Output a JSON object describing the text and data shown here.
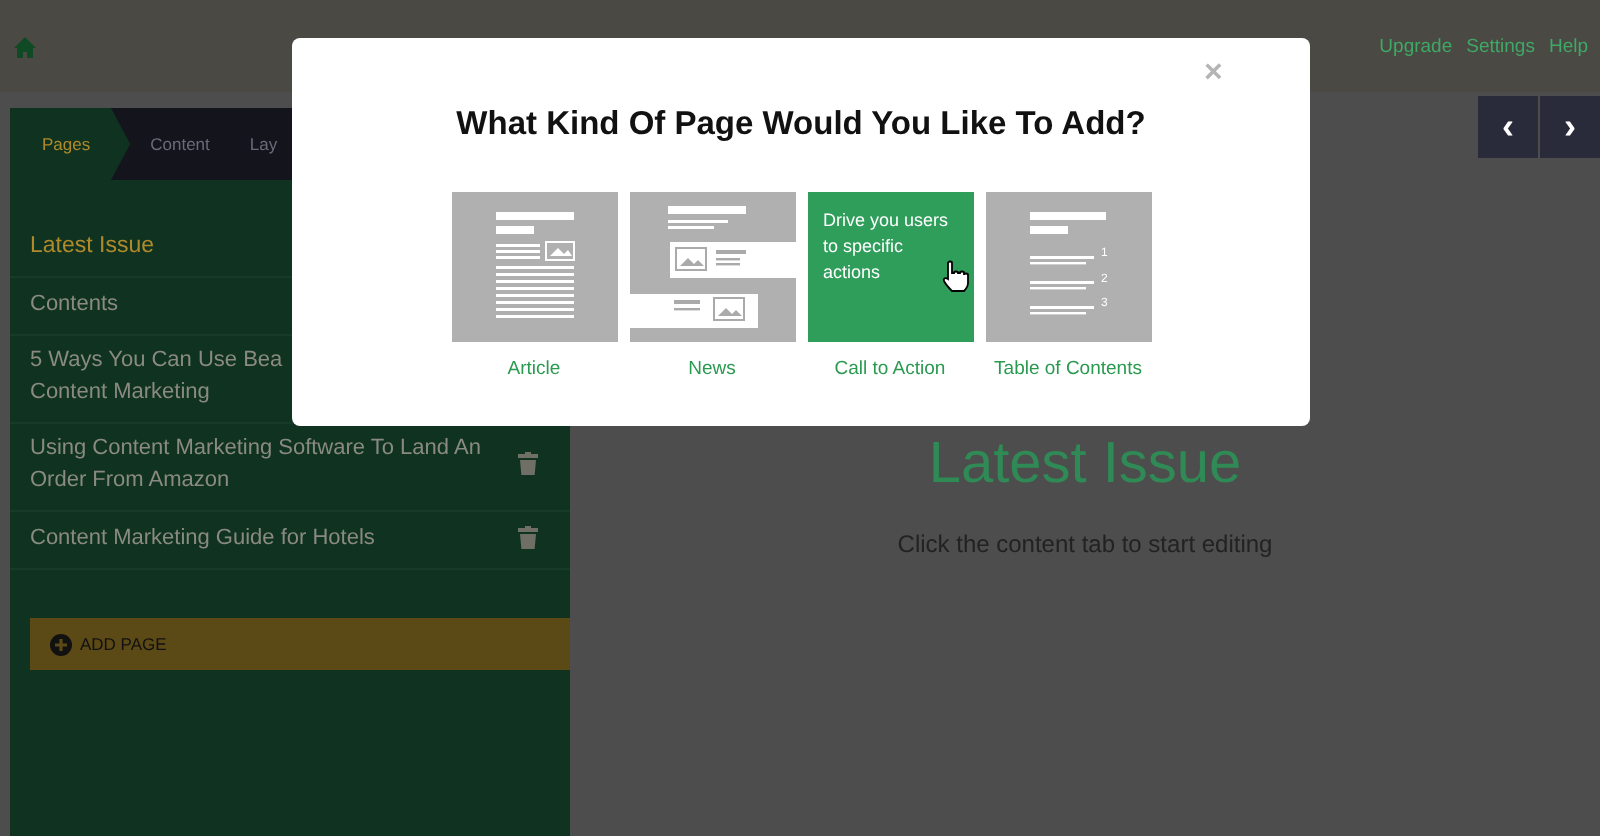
{
  "top_links": [
    "Upgrade",
    "Settings",
    "Help"
  ],
  "sidebar": {
    "tabs": [
      {
        "label": "Pages",
        "selected": true
      },
      {
        "label": "Content",
        "selected": false
      },
      {
        "label": "Lay",
        "selected": false
      }
    ],
    "items": [
      {
        "lines": [
          "Latest Issue"
        ],
        "selected": true
      },
      {
        "lines": [
          "Contents"
        ],
        "selected": false
      },
      {
        "lines": [
          "5 Ways You Can Use Bea",
          "Content Marketing"
        ],
        "selected": false
      },
      {
        "lines": [
          "Using Content Marketing Software To Land An",
          "Order From Amazon"
        ],
        "selected": false,
        "deletable": true
      },
      {
        "lines": [
          "Content Marketing Guide for Hotels"
        ],
        "selected": false,
        "deletable": true
      }
    ],
    "add_button": "ADD PAGE"
  },
  "main": {
    "heading": "Latest Issue",
    "hint": "Click the content tab to start editing"
  },
  "nav_buttons": [
    "‹",
    "›"
  ],
  "dialog": {
    "close": "×",
    "title": "What Kind Of Page Would You Like To Add?",
    "options": [
      {
        "kind": "article",
        "label": "Article",
        "selected": false
      },
      {
        "kind": "news",
        "label": "News",
        "selected": false
      },
      {
        "kind": "action",
        "label": "Call to Action",
        "selected": true,
        "description": "Drive you users to specific actions"
      },
      {
        "kind": "toc",
        "label": "Table of Contents",
        "selected": false,
        "numbers": [
          "1",
          "2",
          "3"
        ]
      }
    ]
  }
}
